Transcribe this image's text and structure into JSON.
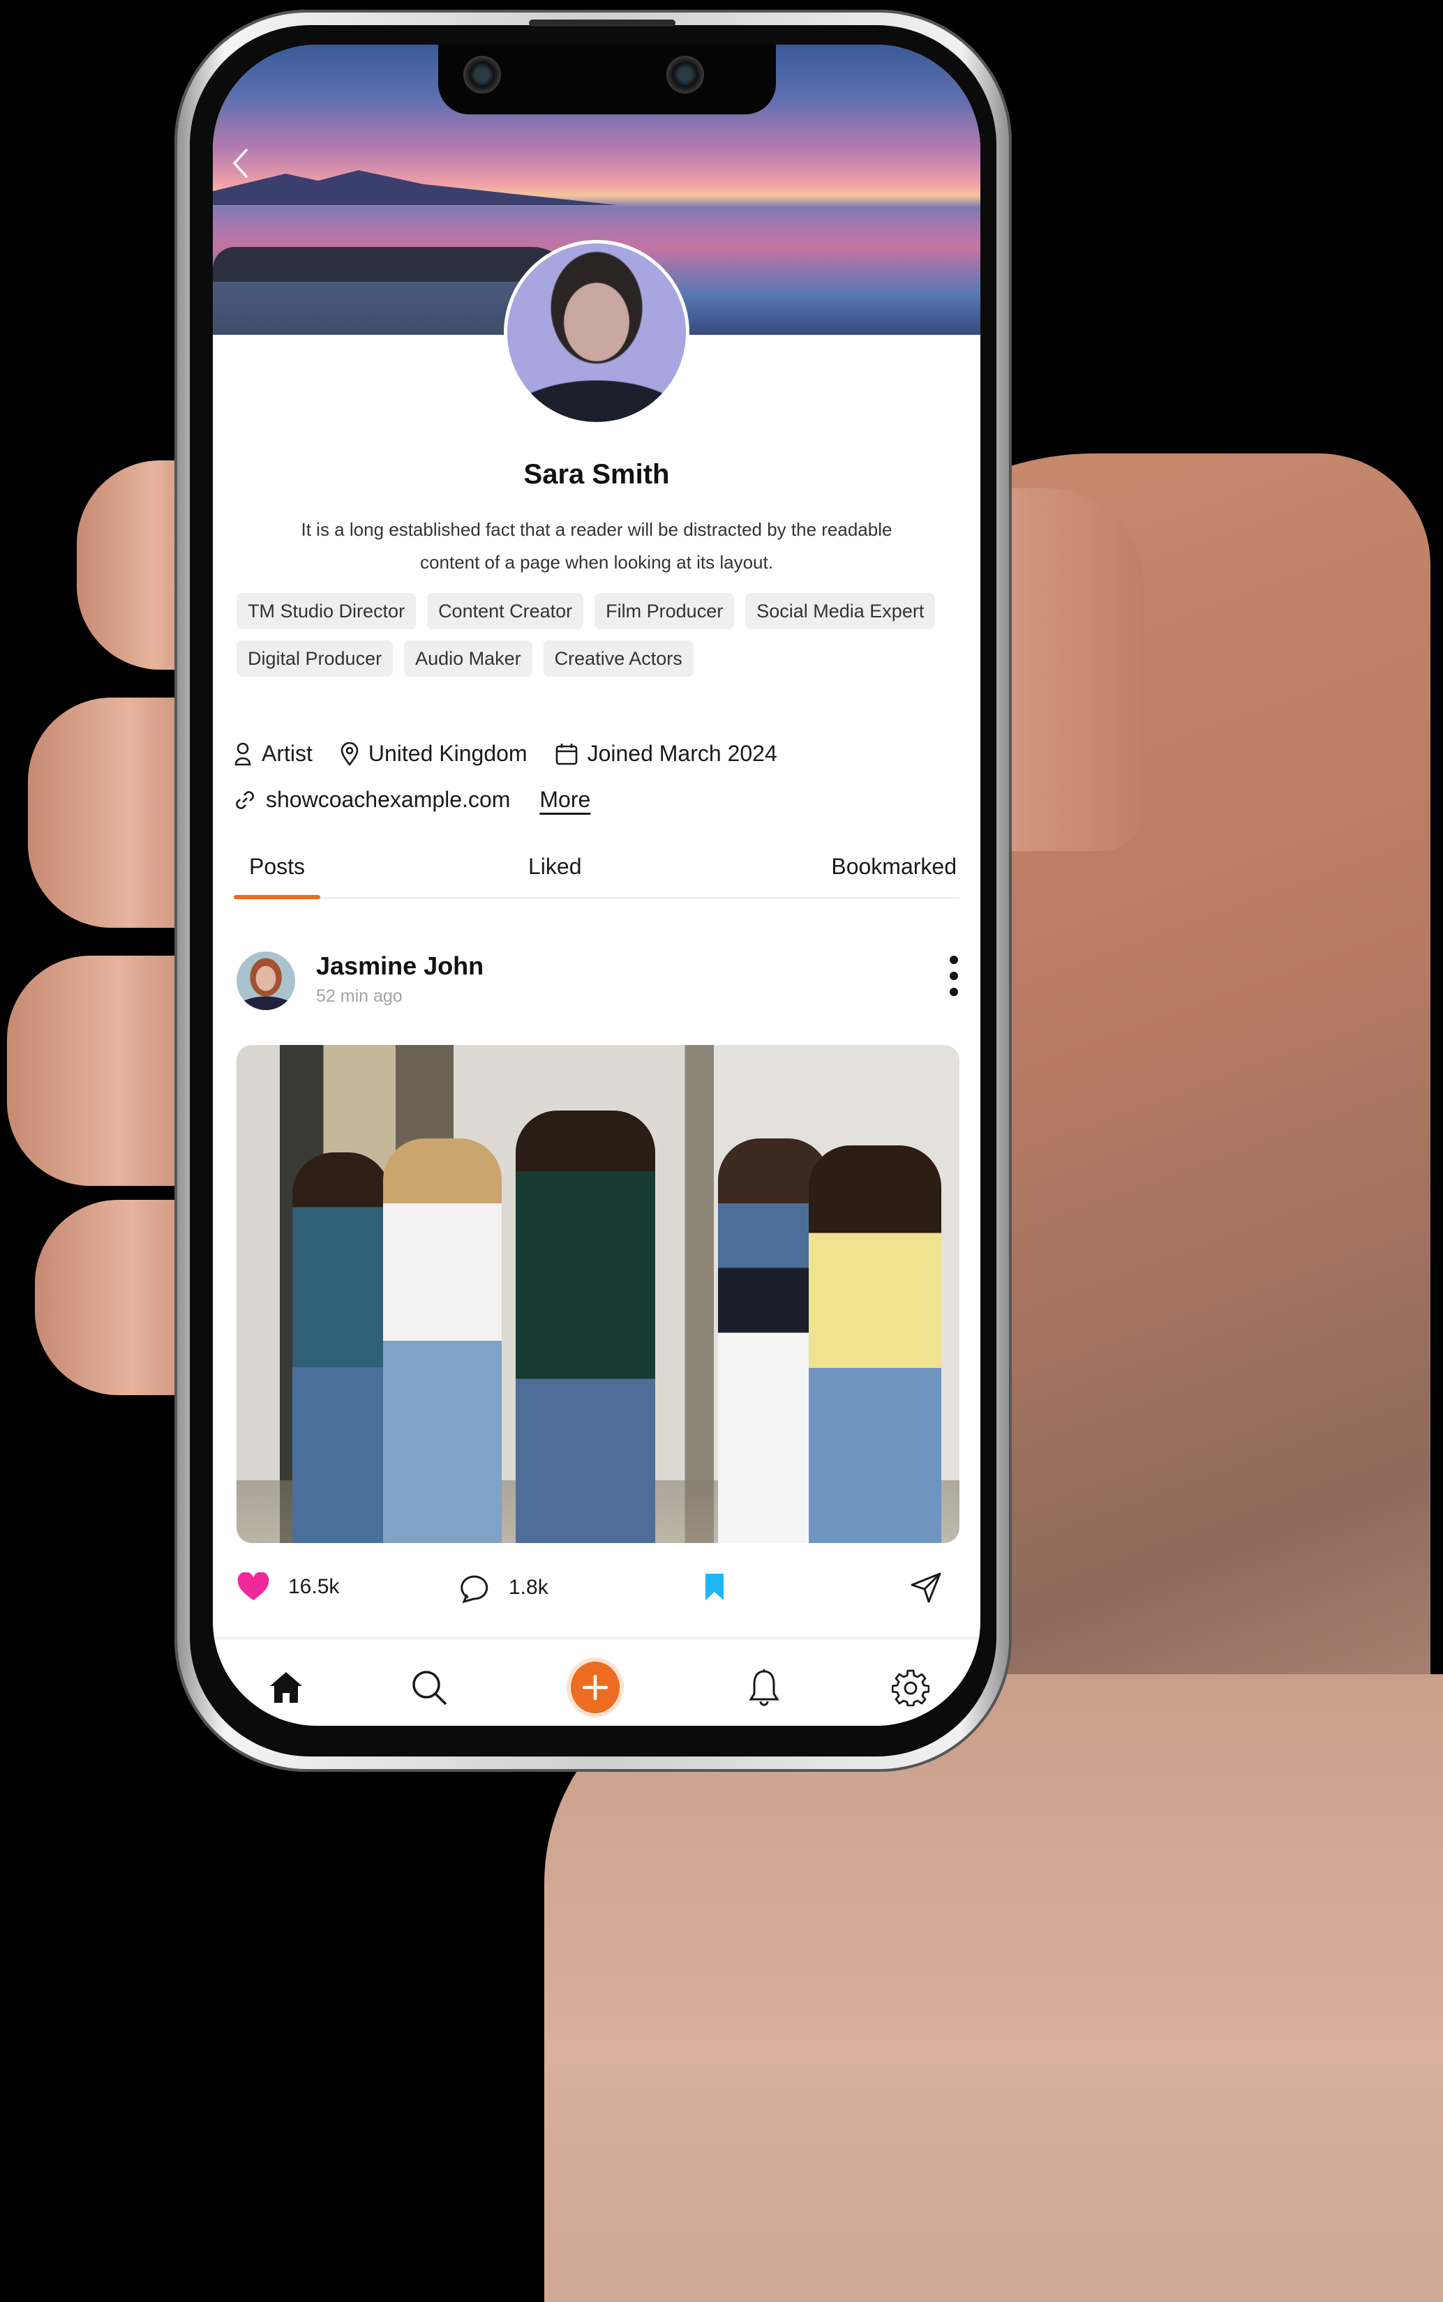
{
  "profile": {
    "name": "Sara Smith",
    "bio": "It is a long established fact that a reader will be distracted by the readable content of a page when looking at its layout.",
    "tags": [
      "TM Studio Director",
      "Content Creator",
      "Film Producer",
      "Social Media Expert",
      "Digital Producer",
      "Audio Maker",
      "Creative Actors"
    ],
    "role": "Artist",
    "location": "United Kingdom",
    "joined": "Joined March 2024",
    "website": "showcoachexample.com",
    "more_label": "More"
  },
  "tabs": [
    {
      "label": "Posts",
      "active": true
    },
    {
      "label": "Liked",
      "active": false
    },
    {
      "label": "Bookmarked",
      "active": false
    }
  ],
  "post": {
    "author": "Jasmine John",
    "time": "52 min ago",
    "likes": "16.5k",
    "comments": "1.8k",
    "bookmarked": true
  },
  "bottom_nav": [
    {
      "icon": "home-icon",
      "active": true
    },
    {
      "icon": "search-icon",
      "active": false
    },
    {
      "icon": "add-icon",
      "active": false
    },
    {
      "icon": "bell-icon",
      "active": false
    },
    {
      "icon": "gear-icon",
      "active": false
    }
  ],
  "colors": {
    "accent": "#ec6d1f",
    "like": "#f0289a",
    "bookmark": "#1fb6f5",
    "tag_bg": "#efefef",
    "muted_text": "#a3a3a3"
  }
}
